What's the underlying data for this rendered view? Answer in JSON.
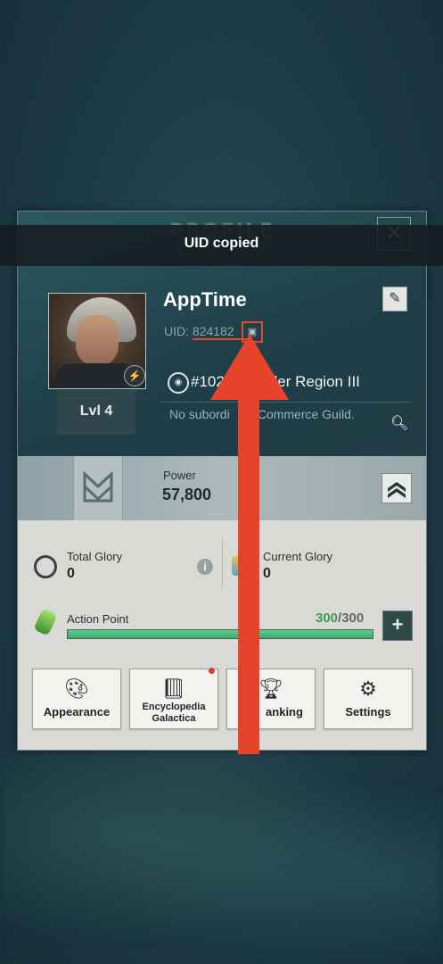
{
  "header": {
    "title": "PROFILE",
    "close_icon": "close-icon"
  },
  "toast": {
    "text": "UID copied"
  },
  "player": {
    "name": "AppTime",
    "uid_label": "UID: 824182",
    "level": "Lvl 4",
    "region": "#102",
    "region_suffix": "der Region III",
    "guild": "No subordi     e Commerce Guild."
  },
  "power": {
    "label": "Power",
    "value": "57,800"
  },
  "glory": {
    "total_label": "Total Glory",
    "total_value": "0",
    "current_label": "Current Glory",
    "current_value": "0"
  },
  "action_point": {
    "label": "Action Point",
    "current": "300",
    "max": "/300",
    "fill_fraction": 1.0
  },
  "menu": {
    "appearance": "Appearance",
    "encyclopedia_line1": "Encyclopedia",
    "encyclopedia_line2": "Galactica",
    "ranking": "anking",
    "settings": "Settings"
  },
  "colors": {
    "accent_red": "#e6432b",
    "ap_green": "#3d9c4f",
    "panel_dark": "#1f3f49"
  }
}
